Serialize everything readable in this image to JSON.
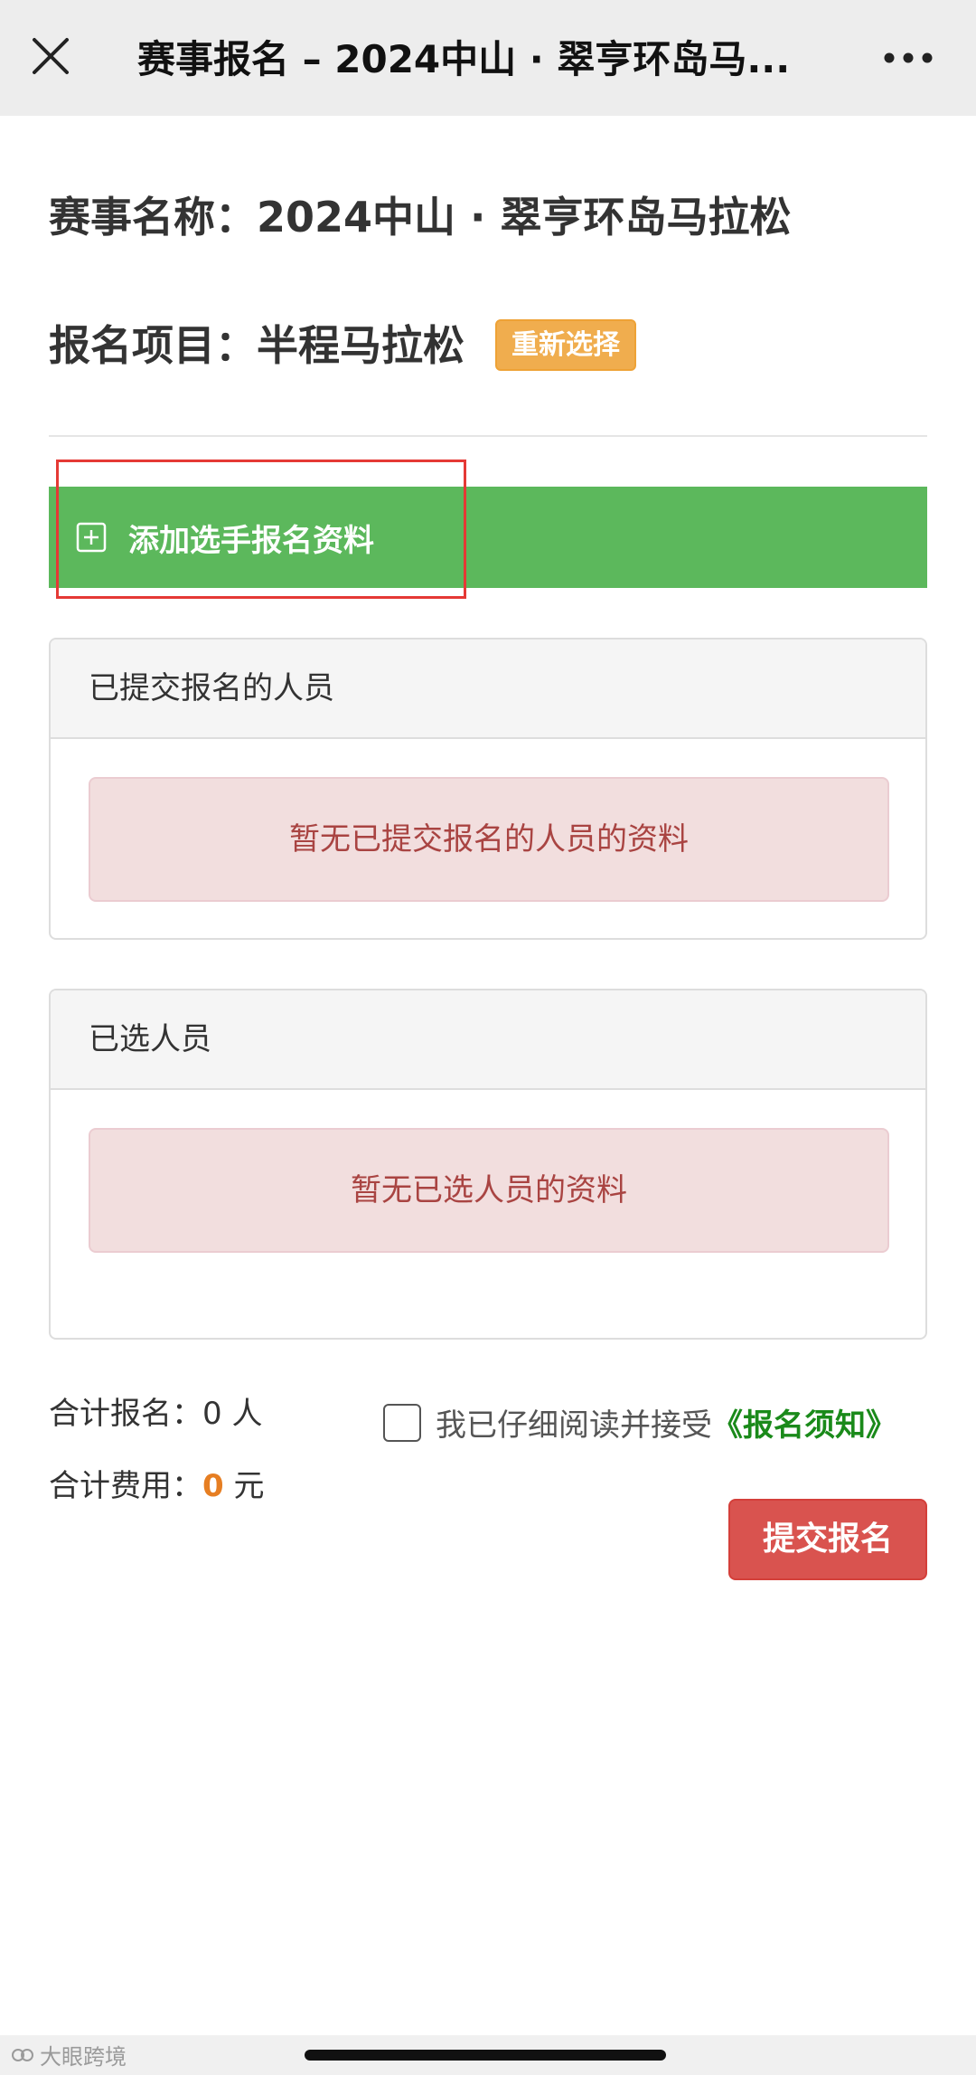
{
  "nav": {
    "title": "赛事报名 – 2024中山 · 翠亨环岛马...",
    "close_icon": "close-icon",
    "more_icon": "more-horizontal-icon"
  },
  "event": {
    "name_label": "赛事名称：",
    "name_value": "2024中山 · 翠亨环岛马拉松",
    "item_label": "报名项目：",
    "item_value": "半程马拉松",
    "reselect_label": "重新选择"
  },
  "add_participant": {
    "icon": "plus-square-icon",
    "label": "添加选手报名资料",
    "highlight_color": "#e53935"
  },
  "submitted_panel": {
    "heading": "已提交报名的人员",
    "empty_message": "暂无已提交报名的人员的资料"
  },
  "selected_panel": {
    "heading": "已选人员",
    "empty_message": "暂无已选人员的资料"
  },
  "summary": {
    "count_label": "合计报名：",
    "count_value": "0",
    "count_unit": "人",
    "fee_label": "合计费用：",
    "fee_value": "0",
    "fee_unit": "元"
  },
  "agreement": {
    "checked": false,
    "text": "我已仔细阅读并接受",
    "link": "《报名须知》"
  },
  "submit_label": "提交报名",
  "watermark": {
    "text": "大眼跨境"
  },
  "colors": {
    "success": "#5cb85c",
    "warning": "#f0ad4e",
    "danger": "#d9534f",
    "alert_bg": "#f2dede",
    "alert_text": "#a94442",
    "fee_accent": "#e67e22",
    "link_green": "#1a8a1a"
  }
}
